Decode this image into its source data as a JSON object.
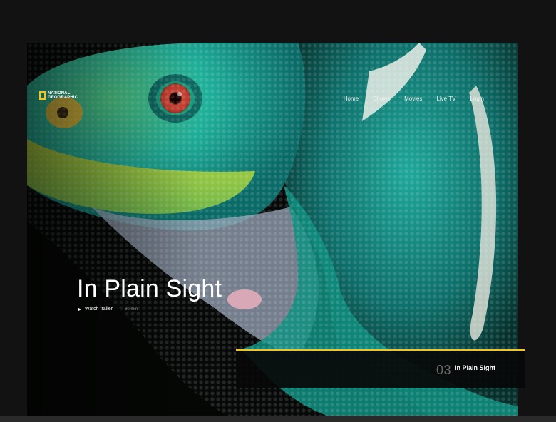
{
  "brand": {
    "logo_text": "NATIONAL GEOGRAPHIC"
  },
  "nav": {
    "items": [
      "Home",
      "Shows",
      "Movies",
      "Live TV",
      "Login"
    ]
  },
  "hero": {
    "title": "In Plain Sight",
    "trailer_label": "Watch trailer",
    "duration": "60 min"
  },
  "featured_card": {
    "number": "03",
    "title": "In Plain Sight"
  },
  "colors": {
    "accent": "#f5c518",
    "background": "#121212"
  },
  "icons": {
    "logo": "yellow-rectangle-logo-icon",
    "play": "play-icon"
  }
}
